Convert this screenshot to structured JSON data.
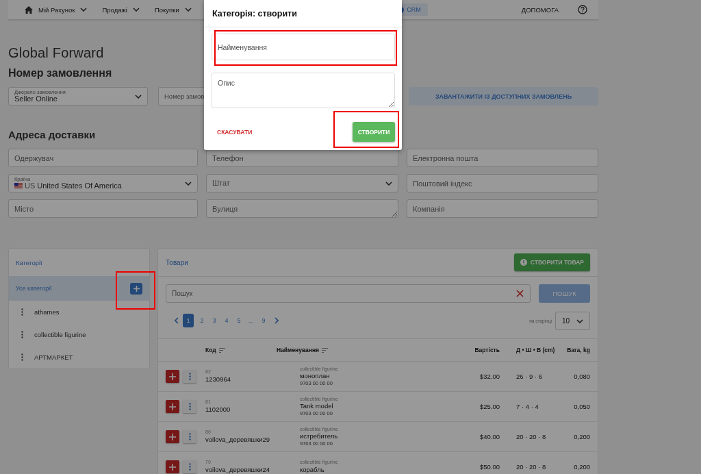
{
  "nav": {
    "items": [
      {
        "kind": "home"
      },
      {
        "kind": "menu",
        "label": "Мій Рахунок"
      },
      {
        "kind": "menu",
        "label": "Продажі"
      },
      {
        "kind": "menu",
        "label": "Покупки"
      },
      {
        "kind": "badge",
        "label": "CRM"
      },
      {
        "kind": "link",
        "label": "ДОПОМОГА"
      },
      {
        "kind": "help"
      }
    ]
  },
  "page_title": "Global Forward",
  "order": {
    "heading": "Номер замовлення",
    "fields": [
      {
        "kind": "select",
        "label": "Джерело замовлення",
        "value": "Seller Online"
      },
      {
        "kind": "input",
        "placeholder": "Номер замов"
      }
    ],
    "button": "ЗАВАНТАЖИТИ ІЗ ДОСТУПНИХ ЗАМОВЛЕНЬ"
  },
  "address": {
    "heading": "Адреса доставки",
    "fields": [
      {
        "kind": "input",
        "placeholder": "Одержувач"
      },
      {
        "kind": "input",
        "placeholder": "Телефон"
      },
      {
        "kind": "input",
        "placeholder": "Електронна пошта"
      },
      {
        "kind": "select",
        "label": "Країна",
        "code": "US",
        "value": "United States Of America"
      },
      {
        "kind": "select",
        "placeholder": "Штат"
      },
      {
        "kind": "input",
        "placeholder": "Поштовий індекс"
      },
      {
        "kind": "input",
        "placeholder": "Місто"
      },
      {
        "kind": "textarea",
        "placeholder": "Вулиця"
      },
      {
        "kind": "input",
        "placeholder": "Компанія"
      }
    ]
  },
  "categories": {
    "title": "Категорії",
    "items": [
      {
        "label": "Усе категорії",
        "selected": true
      },
      {
        "label": "athames",
        "selected": false
      },
      {
        "label": "collectible figurine",
        "selected": false
      },
      {
        "label": "АРТМАРКЕТ",
        "selected": false
      }
    ]
  },
  "products": {
    "title": "Товари",
    "create_button": "СТВОРИТИ ТОВАР",
    "search": {
      "placeholder": "Пошук"
    },
    "search_button": "ПОШУК",
    "pages": [
      {
        "label": "1",
        "selected": true
      },
      {
        "label": "2",
        "selected": false
      },
      {
        "label": "3",
        "selected": false
      },
      {
        "label": "4",
        "selected": false
      },
      {
        "label": "5",
        "selected": false
      },
      {
        "label": "...",
        "selected": false
      },
      {
        "label": "9",
        "selected": false
      }
    ],
    "per_page_label": "на сторінці",
    "per_page": "10",
    "columns": [
      {
        "label": "Код",
        "sortable": true
      },
      {
        "label": "Найменування",
        "sortable": true
      },
      {
        "label": "Вартість",
        "sortable": false
      },
      {
        "label": "Д • Ш • В (cm)",
        "sortable": false
      },
      {
        "label": "Вага, kg",
        "sortable": false
      }
    ],
    "rows": [
      {
        "id": "82",
        "code": "1230964",
        "category": "collectible figurine",
        "name": "моноплан",
        "hs_code": "9703 00 00 00",
        "price": "$32.00",
        "dims": "26 · 9 · 6",
        "weight": "0,080"
      },
      {
        "id": "81",
        "code": "1102000",
        "category": "collectible figurine",
        "name": "Tank model",
        "hs_code": "9703 00 00 00",
        "price": "$25.00",
        "dims": "7 · 4 · 4",
        "weight": "0,050"
      },
      {
        "id": "80",
        "code": "voilova_деревяшки29",
        "category": "collectible figurine",
        "name": "истребитель",
        "hs_code": "9703 00 00 00",
        "price": "$40.00",
        "dims": "20 · 20 · 8",
        "weight": "0,200"
      },
      {
        "id": "79",
        "code": "voilova_деревяшки24",
        "category": "collectible figurine",
        "name": "корабль",
        "price": "$50.00",
        "dims": "20 · 20 · 8",
        "weight": "0,200"
      }
    ]
  },
  "modal": {
    "title": "Категорія: створити",
    "name_field": {
      "placeholder": "Найменування"
    },
    "description_field": {
      "placeholder": "Опис"
    },
    "cancel": "СКАСУВАТИ",
    "create": "СТВОРИТИ"
  }
}
